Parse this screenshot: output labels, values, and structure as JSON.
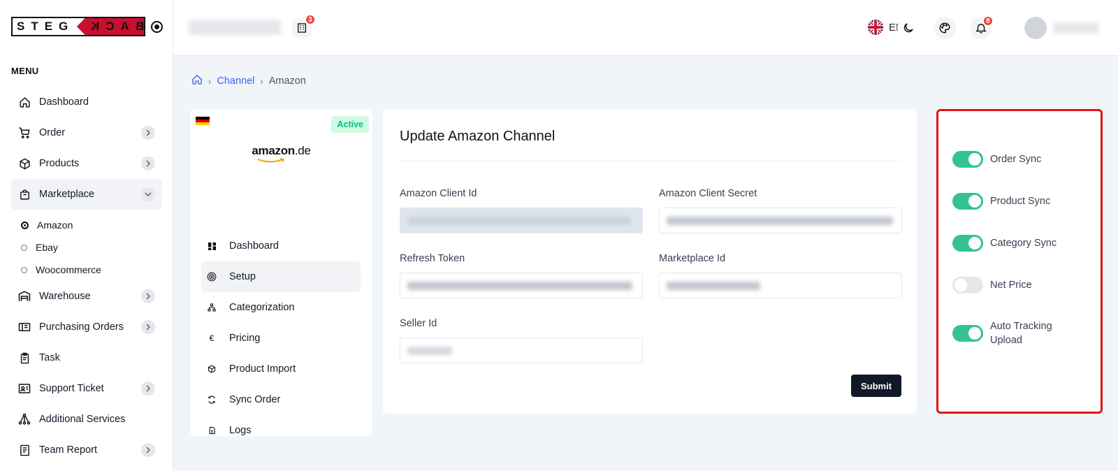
{
  "brand": {
    "logo_left": "STEG",
    "logo_right": "BACK"
  },
  "sidebar": {
    "menu_title": "MENU",
    "items": [
      {
        "label": "Dashboard"
      },
      {
        "label": "Order"
      },
      {
        "label": "Products"
      },
      {
        "label": "Marketplace"
      },
      {
        "label": "Warehouse"
      },
      {
        "label": "Purchasing Orders"
      },
      {
        "label": "Task"
      },
      {
        "label": "Support Ticket"
      },
      {
        "label": "Additional Services"
      },
      {
        "label": "Team Report"
      }
    ],
    "marketplace_sub": [
      {
        "label": "Amazon"
      },
      {
        "label": "Ebay"
      },
      {
        "label": "Woocommerce"
      }
    ]
  },
  "header": {
    "company_badge": "3",
    "language": "EN",
    "notifications_badge": "8"
  },
  "breadcrumb": {
    "channel": "Channel",
    "current": "Amazon"
  },
  "channel_card": {
    "status": "Active",
    "logo_main": "amazon",
    "logo_tld": ".de",
    "nav": [
      {
        "label": "Dashboard"
      },
      {
        "label": "Setup"
      },
      {
        "label": "Categorization"
      },
      {
        "label": "Pricing"
      },
      {
        "label": "Product Import"
      },
      {
        "label": "Sync Order"
      },
      {
        "label": "Logs"
      }
    ]
  },
  "form": {
    "title": "Update Amazon Channel",
    "client_id_label": "Amazon Client Id",
    "client_secret_label": "Amazon Client Secret",
    "refresh_token_label": "Refresh Token",
    "marketplace_id_label": "Marketplace Id",
    "seller_id_label": "Seller Id",
    "submit_label": "Submit"
  },
  "sync": {
    "order_sync": {
      "label": "Order Sync",
      "on": true
    },
    "product_sync": {
      "label": "Product Sync",
      "on": true
    },
    "category_sync": {
      "label": "Category Sync",
      "on": true
    },
    "net_price": {
      "label": "Net Price",
      "on": false
    },
    "auto_tracking": {
      "label_line1": "Auto Tracking",
      "label_line2": "Upload",
      "on": true
    }
  },
  "colors": {
    "accent": "#3b63e8",
    "toggle_on": "#34c38f",
    "highlight": "#e11414",
    "badge": "#ef4444",
    "active_badge_text": "#10b981"
  }
}
